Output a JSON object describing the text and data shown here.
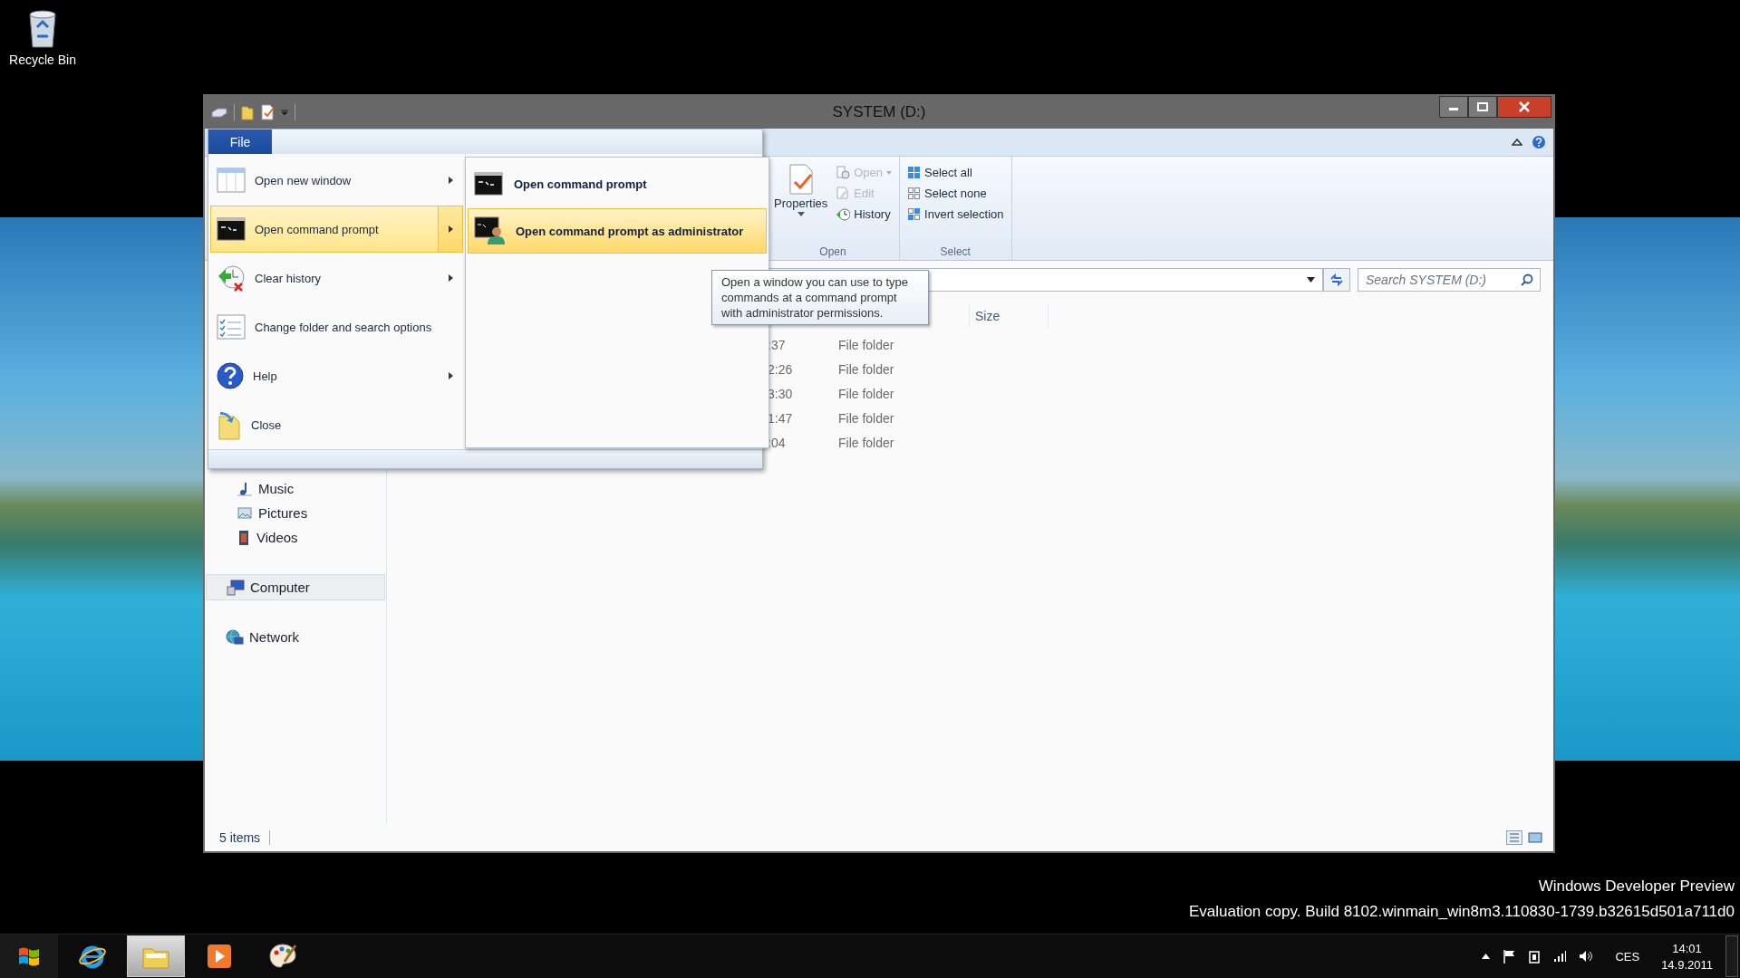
{
  "desktop": {
    "icons": [
      {
        "label": "Recycle Bin",
        "kind": "recycle"
      }
    ],
    "watermark": [
      "Windows Developer Preview",
      "Evaluation copy. Build 8102.winmain_win8m3.110830-1739.b32615d501a711d0"
    ]
  },
  "window": {
    "title": "SYSTEM (D:)",
    "ribbon": {
      "groups": [
        {
          "label": "Open",
          "items": [
            {
              "label": "Properties",
              "kind": "large",
              "disabled": false
            },
            {
              "label": "Open",
              "kind": "dropdown",
              "disabled": true
            },
            {
              "label": "Edit",
              "kind": "edit",
              "disabled": true
            },
            {
              "label": "History",
              "kind": "history",
              "disabled": false
            }
          ]
        },
        {
          "label": "Select",
          "items": [
            {
              "label": "Select all",
              "kind": "all",
              "disabled": false
            },
            {
              "label": "Select none",
              "kind": "none",
              "disabled": false
            },
            {
              "label": "Invert selection",
              "kind": "invert",
              "disabled": false
            }
          ]
        }
      ]
    },
    "search": {
      "placeholder": "Search SYSTEM (D:)"
    },
    "columns": [
      {
        "label": "Size"
      }
    ],
    "rows": [
      {
        "date": ":37",
        "type": "File folder"
      },
      {
        "date": "2:26",
        "type": "File folder"
      },
      {
        "date": "3:30",
        "type": "File folder"
      },
      {
        "date": "1:47",
        "type": "File folder"
      },
      {
        "date": ":04",
        "type": "File folder"
      }
    ],
    "sidebar": {
      "items": [
        {
          "label": "Music",
          "kind": "music",
          "selected": false,
          "indent": true
        },
        {
          "label": "Pictures",
          "kind": "pictures",
          "selected": false,
          "indent": true
        },
        {
          "label": "Videos",
          "kind": "videos",
          "selected": false,
          "indent": true
        },
        {
          "label": "Computer",
          "kind": "computer",
          "selected": true,
          "indent": false
        },
        {
          "label": "Network",
          "kind": "network",
          "selected": false,
          "indent": false
        }
      ]
    },
    "status_bar": {
      "text": "5 items"
    }
  },
  "file_menu": {
    "tab": "File",
    "items": [
      {
        "label": "Open new window",
        "kind": "window",
        "submenu": true,
        "selected": false
      },
      {
        "label": "Open command prompt",
        "kind": "cmd",
        "submenu": true,
        "selected": true
      },
      {
        "label": "Clear history",
        "kind": "clear",
        "submenu": true,
        "selected": false
      },
      {
        "label": "Change folder and search options",
        "kind": "options",
        "submenu": false,
        "selected": false
      },
      {
        "label": "Help",
        "kind": "help",
        "submenu": true,
        "selected": false
      },
      {
        "label": "Close",
        "kind": "close",
        "submenu": false,
        "selected": false
      }
    ],
    "submenu": [
      {
        "label": "Open command prompt",
        "kind": "cmd",
        "selected": false
      },
      {
        "label": "Open command prompt as administrator",
        "kind": "admin",
        "selected": true
      }
    ],
    "tooltip": "Open a window you can use to type commands at a command prompt with administrator permissions."
  },
  "taskbar": {
    "apps": [
      {
        "kind": "browser",
        "active": false
      },
      {
        "kind": "explorer",
        "active": true
      },
      {
        "kind": "media",
        "active": false
      },
      {
        "kind": "paint",
        "active": false
      }
    ],
    "tray": {
      "language": "CES",
      "time": "14:01",
      "date": "14.9.2011"
    }
  }
}
